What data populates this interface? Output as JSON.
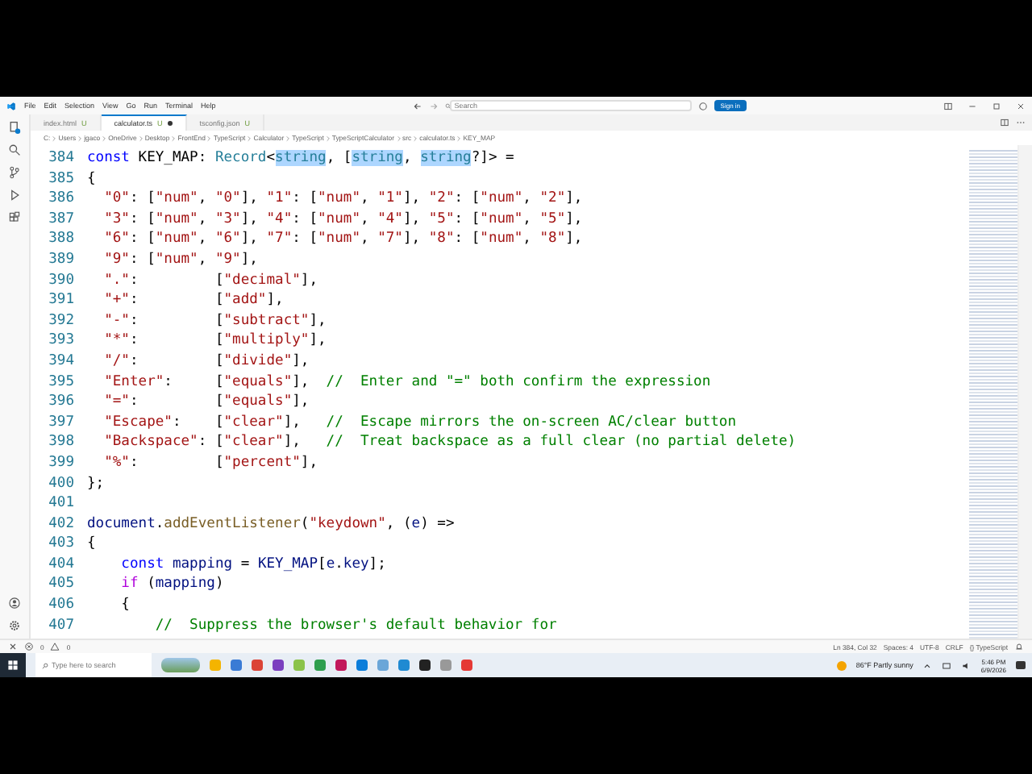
{
  "window": {
    "menu": [
      "File",
      "Edit",
      "Selection",
      "View",
      "Go",
      "Run",
      "Terminal",
      "Help"
    ],
    "search": {
      "placeholder": "Search"
    },
    "sign_in": "Sign in"
  },
  "tabs": [
    {
      "label": "index.html",
      "badge": "U",
      "selected": false,
      "modified": false
    },
    {
      "label": "calculator.ts",
      "badge": "U",
      "selected": true,
      "modified": true
    },
    {
      "label": "tsconfig.json",
      "badge": "U",
      "selected": false,
      "modified": false
    }
  ],
  "breadcrumb": [
    "C:",
    "Users",
    "jgaco",
    "OneDrive",
    "Desktop",
    "FrontEnd",
    "TypeScript",
    "Calculator",
    "TypeScript",
    "TypeScriptCalculator",
    "src",
    "calculator.ts",
    "KEY_MAP"
  ],
  "code": {
    "lines": [
      {
        "number": "384",
        "tokens": [
          {
            "kind": "keyword",
            "text": "const"
          },
          {
            "kind": "plain",
            "text": " KEY_MAP: "
          },
          {
            "kind": "type",
            "text": "Record"
          },
          {
            "kind": "plain",
            "text": "<"
          },
          {
            "kind": "match",
            "text": "string"
          },
          {
            "kind": "plain",
            "text": ", ["
          },
          {
            "kind": "match",
            "text": "string"
          },
          {
            "kind": "plain",
            "text": ", "
          },
          {
            "kind": "match",
            "text": "string"
          },
          {
            "kind": "plain",
            "text": "?]> ="
          }
        ]
      },
      {
        "number": "385",
        "tokens": [
          {
            "kind": "plain",
            "text": "{"
          }
        ]
      },
      {
        "number": "386",
        "tokens": [
          {
            "kind": "string",
            "text": "  \"0\""
          },
          {
            "kind": "plain",
            "text": ": ["
          },
          {
            "kind": "string",
            "text": "\"num\""
          },
          {
            "kind": "plain",
            "text": ", "
          },
          {
            "kind": "string",
            "text": "\"0\""
          },
          {
            "kind": "plain",
            "text": "], "
          },
          {
            "kind": "string",
            "text": "\"1\""
          },
          {
            "kind": "plain",
            "text": ": ["
          },
          {
            "kind": "string",
            "text": "\"num\""
          },
          {
            "kind": "plain",
            "text": ", "
          },
          {
            "kind": "string",
            "text": "\"1\""
          },
          {
            "kind": "plain",
            "text": "], "
          },
          {
            "kind": "string",
            "text": "\"2\""
          },
          {
            "kind": "plain",
            "text": ": ["
          },
          {
            "kind": "string",
            "text": "\"num\""
          },
          {
            "kind": "plain",
            "text": ", "
          },
          {
            "kind": "string",
            "text": "\"2\""
          },
          {
            "kind": "plain",
            "text": "],"
          }
        ]
      },
      {
        "number": "387",
        "tokens": [
          {
            "kind": "string",
            "text": "  \"3\""
          },
          {
            "kind": "plain",
            "text": ": ["
          },
          {
            "kind": "string",
            "text": "\"num\""
          },
          {
            "kind": "plain",
            "text": ", "
          },
          {
            "kind": "string",
            "text": "\"3\""
          },
          {
            "kind": "plain",
            "text": "], "
          },
          {
            "kind": "string",
            "text": "\"4\""
          },
          {
            "kind": "plain",
            "text": ": ["
          },
          {
            "kind": "string",
            "text": "\"num\""
          },
          {
            "kind": "plain",
            "text": ", "
          },
          {
            "kind": "string",
            "text": "\"4\""
          },
          {
            "kind": "plain",
            "text": "], "
          },
          {
            "kind": "string",
            "text": "\"5\""
          },
          {
            "kind": "plain",
            "text": ": ["
          },
          {
            "kind": "string",
            "text": "\"num\""
          },
          {
            "kind": "plain",
            "text": ", "
          },
          {
            "kind": "string",
            "text": "\"5\""
          },
          {
            "kind": "plain",
            "text": "],"
          }
        ]
      },
      {
        "number": "388",
        "tokens": [
          {
            "kind": "string",
            "text": "  \"6\""
          },
          {
            "kind": "plain",
            "text": ": ["
          },
          {
            "kind": "string",
            "text": "\"num\""
          },
          {
            "kind": "plain",
            "text": ", "
          },
          {
            "kind": "string",
            "text": "\"6\""
          },
          {
            "kind": "plain",
            "text": "], "
          },
          {
            "kind": "string",
            "text": "\"7\""
          },
          {
            "kind": "plain",
            "text": ": ["
          },
          {
            "kind": "string",
            "text": "\"num\""
          },
          {
            "kind": "plain",
            "text": ", "
          },
          {
            "kind": "string",
            "text": "\"7\""
          },
          {
            "kind": "plain",
            "text": "], "
          },
          {
            "kind": "string",
            "text": "\"8\""
          },
          {
            "kind": "plain",
            "text": ": ["
          },
          {
            "kind": "string",
            "text": "\"num\""
          },
          {
            "kind": "plain",
            "text": ", "
          },
          {
            "kind": "string",
            "text": "\"8\""
          },
          {
            "kind": "plain",
            "text": "],"
          }
        ]
      },
      {
        "number": "389",
        "tokens": [
          {
            "kind": "string",
            "text": "  \"9\""
          },
          {
            "kind": "plain",
            "text": ": ["
          },
          {
            "kind": "string",
            "text": "\"num\""
          },
          {
            "kind": "plain",
            "text": ", "
          },
          {
            "kind": "string",
            "text": "\"9\""
          },
          {
            "kind": "plain",
            "text": "],"
          }
        ]
      },
      {
        "number": "390",
        "tokens": [
          {
            "kind": "string",
            "text": "  \".\""
          },
          {
            "kind": "plain",
            "text": ":         ["
          },
          {
            "kind": "string",
            "text": "\"decimal\""
          },
          {
            "kind": "plain",
            "text": "],"
          }
        ]
      },
      {
        "number": "391",
        "tokens": [
          {
            "kind": "string",
            "text": "  \"+\""
          },
          {
            "kind": "plain",
            "text": ":         ["
          },
          {
            "kind": "string",
            "text": "\"add\""
          },
          {
            "kind": "plain",
            "text": "],"
          }
        ]
      },
      {
        "number": "392",
        "tokens": [
          {
            "kind": "string",
            "text": "  \"-\""
          },
          {
            "kind": "plain",
            "text": ":         ["
          },
          {
            "kind": "string",
            "text": "\"subtract\""
          },
          {
            "kind": "plain",
            "text": "],"
          }
        ]
      },
      {
        "number": "393",
        "tokens": [
          {
            "kind": "string",
            "text": "  \"*\""
          },
          {
            "kind": "plain",
            "text": ":         ["
          },
          {
            "kind": "string",
            "text": "\"multiply\""
          },
          {
            "kind": "plain",
            "text": "],"
          }
        ]
      },
      {
        "number": "394",
        "tokens": [
          {
            "kind": "string",
            "text": "  \"/\""
          },
          {
            "kind": "plain",
            "text": ":         ["
          },
          {
            "kind": "string",
            "text": "\"divide\""
          },
          {
            "kind": "plain",
            "text": "],"
          }
        ]
      },
      {
        "number": "395",
        "tokens": [
          {
            "kind": "string",
            "text": "  \"Enter\""
          },
          {
            "kind": "plain",
            "text": ":     ["
          },
          {
            "kind": "string",
            "text": "\"equals\""
          },
          {
            "kind": "plain",
            "text": "],"
          },
          {
            "kind": "comment",
            "text": "  //  Enter and \"=\" both confirm the expression"
          }
        ]
      },
      {
        "number": "396",
        "tokens": [
          {
            "kind": "string",
            "text": "  \"=\""
          },
          {
            "kind": "plain",
            "text": ":         ["
          },
          {
            "kind": "string",
            "text": "\"equals\""
          },
          {
            "kind": "plain",
            "text": "],"
          }
        ]
      },
      {
        "number": "397",
        "tokens": [
          {
            "kind": "string",
            "text": "  \"Escape\""
          },
          {
            "kind": "plain",
            "text": ":    ["
          },
          {
            "kind": "string",
            "text": "\"clear\""
          },
          {
            "kind": "plain",
            "text": "],"
          },
          {
            "kind": "comment",
            "text": "   //  Escape mirrors the on-screen AC/clear button"
          }
        ]
      },
      {
        "number": "398",
        "tokens": [
          {
            "kind": "string",
            "text": "  \"Backspace\""
          },
          {
            "kind": "plain",
            "text": ": ["
          },
          {
            "kind": "string",
            "text": "\"clear\""
          },
          {
            "kind": "plain",
            "text": "],"
          },
          {
            "kind": "comment",
            "text": "   //  Treat backspace as a full clear (no partial delete)"
          }
        ]
      },
      {
        "number": "399",
        "tokens": [
          {
            "kind": "string",
            "text": "  \"%\""
          },
          {
            "kind": "plain",
            "text": ":         ["
          },
          {
            "kind": "string",
            "text": "\"percent\""
          },
          {
            "kind": "plain",
            "text": "],"
          }
        ]
      },
      {
        "number": "400",
        "tokens": [
          {
            "kind": "plain",
            "text": "};"
          }
        ]
      },
      {
        "number": "401"
      },
      {
        "number": "402",
        "tokens": [
          {
            "kind": "variable",
            "text": "document"
          },
          {
            "kind": "plain",
            "text": "."
          },
          {
            "kind": "function",
            "text": "addEventListener"
          },
          {
            "kind": "plain",
            "text": "("
          },
          {
            "kind": "string",
            "text": "\"keydown\""
          },
          {
            "kind": "plain",
            "text": ", ("
          },
          {
            "kind": "variable",
            "text": "e"
          },
          {
            "kind": "plain",
            "text": ") =>"
          }
        ]
      },
      {
        "number": "403",
        "tokens": [
          {
            "kind": "plain",
            "text": "{"
          }
        ]
      },
      {
        "number": "404",
        "tokens": [
          {
            "kind": "keyword",
            "text": "    const"
          },
          {
            "kind": "variable",
            "text": " mapping"
          },
          {
            "kind": "plain",
            "text": " = "
          },
          {
            "kind": "variable",
            "text": "KEY_MAP"
          },
          {
            "kind": "plain",
            "text": "["
          },
          {
            "kind": "variable",
            "text": "e"
          },
          {
            "kind": "plain",
            "text": "."
          },
          {
            "kind": "variable",
            "text": "key"
          },
          {
            "kind": "plain",
            "text": "];"
          }
        ]
      },
      {
        "number": "405",
        "tokens": [
          {
            "kind": "control",
            "text": "    if"
          },
          {
            "kind": "plain",
            "text": " ("
          },
          {
            "kind": "variable",
            "text": "mapping"
          },
          {
            "kind": "plain",
            "text": ")"
          }
        ]
      },
      {
        "number": "406",
        "tokens": [
          {
            "kind": "plain",
            "text": "    {"
          }
        ]
      },
      {
        "number": "407",
        "tokens": [
          {
            "kind": "comment",
            "text": "        //  Suppress the browser's default behavior for"
          }
        ]
      }
    ]
  },
  "status_bar": {
    "errors": "0",
    "warnings": "0",
    "items": [
      "Ln 384, Col 32",
      "Spaces: 4",
      "UTF-8",
      "CRLF",
      "{} TypeScript"
    ]
  },
  "taskbar": {
    "search_placeholder": "Type here to search",
    "weather": "86°F  Partly sunny",
    "time": "5:46 PM",
    "date": "6/9/2026"
  }
}
